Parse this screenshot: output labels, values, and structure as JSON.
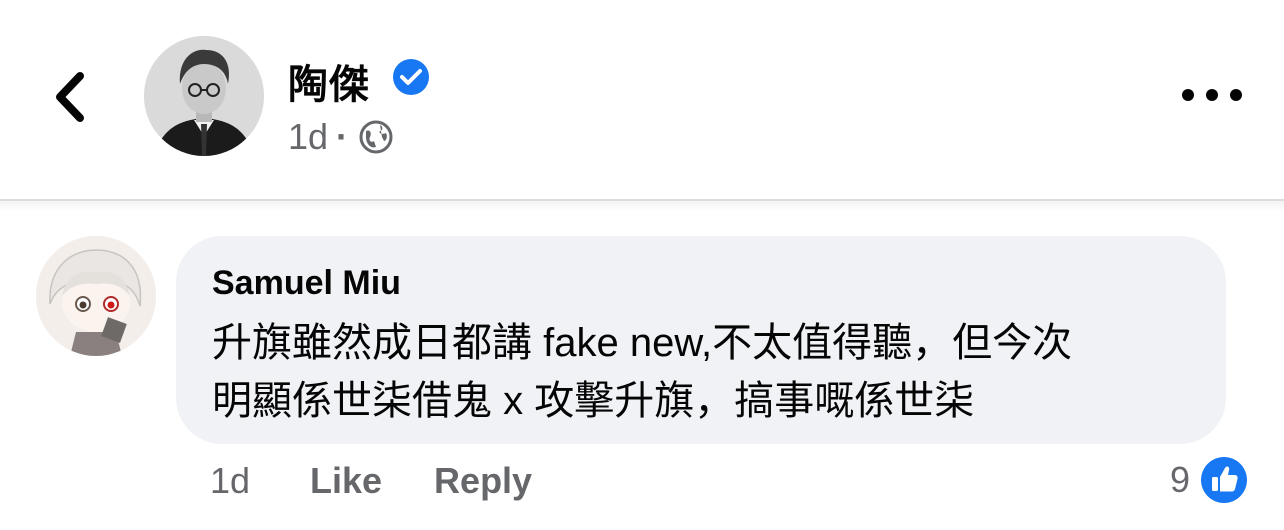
{
  "post_header": {
    "author_name": "陶傑",
    "verified": true,
    "time": "1d",
    "separator": "·",
    "audience_icon": "globe-icon",
    "more_icon": "more-horizontal-icon",
    "back_icon": "chevron-left-icon"
  },
  "comment": {
    "author": "Samuel Miu",
    "text_line1": "升旗雖然成日都講 fake new,不太值得聽，但今次",
    "text_line2": "明顯係世柒借鬼 x 攻擊升旗，搞事嘅係世柒",
    "time": "1d",
    "like_label": "Like",
    "reply_label": "Reply",
    "reaction_count": "9",
    "reaction_icon": "like-reaction-icon"
  },
  "colors": {
    "accent": "#1877f2",
    "bubble": "#f0f2f5",
    "secondary_text": "#65676b"
  }
}
